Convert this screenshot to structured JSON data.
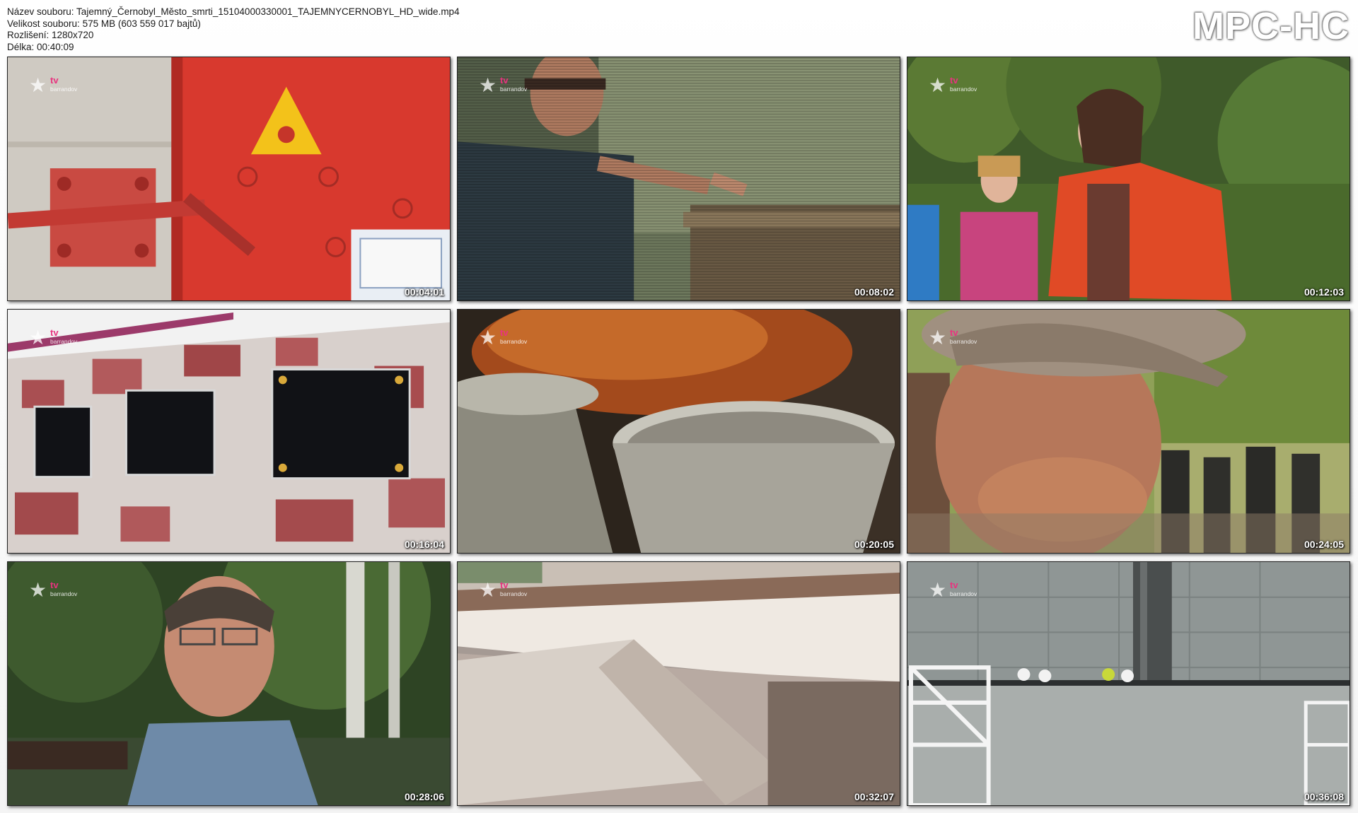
{
  "file_info": {
    "name": "Název souboru: Tajemný_Černobyl_Město_smrti_15104000330001_TAJEMNYCERNOBYL_HD_wide.mp4",
    "size": "Velikost souboru: 575 MB (603 559 017 bajtů)",
    "resolution": "Rozlišení: 1280x720",
    "duration": "Délka: 00:40:09"
  },
  "brand": "MPC-HC",
  "channel_logo": {
    "star": "★",
    "tv": "tv",
    "name": "barrandov"
  },
  "thumbnails": [
    {
      "timestamp": "00:04:01"
    },
    {
      "timestamp": "00:08:02"
    },
    {
      "timestamp": "00:12:03"
    },
    {
      "timestamp": "00:16:04"
    },
    {
      "timestamp": "00:20:05"
    },
    {
      "timestamp": "00:24:05"
    },
    {
      "timestamp": "00:28:06"
    },
    {
      "timestamp": "00:32:07"
    },
    {
      "timestamp": "00:36:08"
    }
  ]
}
